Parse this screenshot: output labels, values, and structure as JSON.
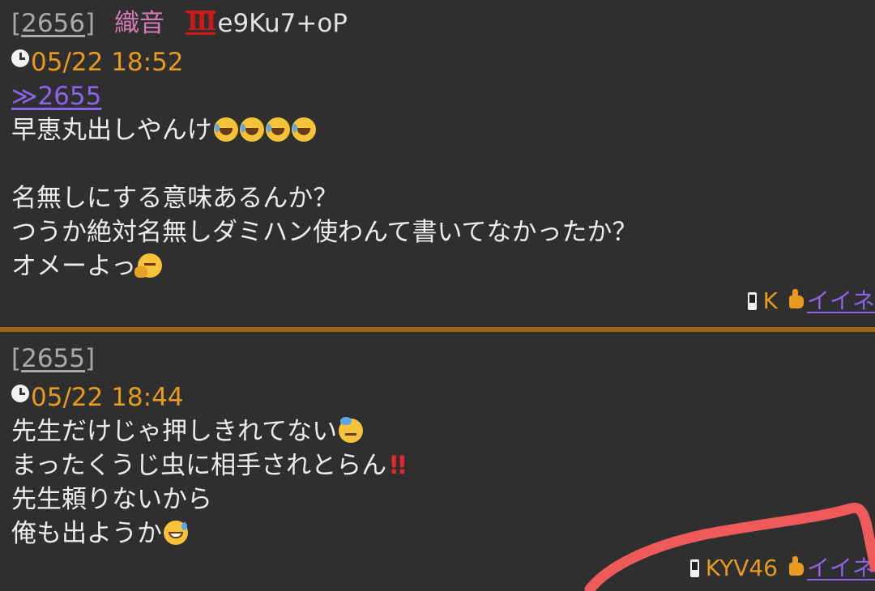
{
  "posts": [
    {
      "number": "2656",
      "name": "織音",
      "rank_badge": "Ⅲ",
      "trip": "e9Ku7+oP",
      "date": "05/22 18:52",
      "anchor": "≫2655",
      "lines": [
        "早恵丸出しやんけ",
        "名無しにする意味あるんか？",
        "つうか絶対名無しダミハン使わんて書いてなかったか？",
        "オメーよっ"
      ],
      "user_id": "K",
      "like_label": "イイネ"
    },
    {
      "number": "2655",
      "date": "05/22 18:44",
      "lines": [
        "先生だけじゃ押しきれてない",
        "まったくうじ虫に相手されとらん",
        "先生頼りないから",
        "俺も出ようか"
      ],
      "user_id": "KYV46",
      "like_label": "イイネ"
    }
  ],
  "icons": {
    "clock": "clock-icon",
    "phone": "phone-icon",
    "like": "thumbs-up-icon",
    "laugh": "rolling-on-floor-laughing-emoji",
    "think": "thinking-face-emoji",
    "sweat": "downcast-sweat-face-emoji",
    "grin": "grinning-sweat-face-emoji",
    "bang": "double-exclamation-emoji"
  },
  "colors": {
    "background": "#2f2f2f",
    "separator": "#9b6716",
    "date": "#e79a1e",
    "link": "#8a63e6",
    "name": "#d07ab6",
    "annotation_stroke": "#ee5a5a"
  }
}
